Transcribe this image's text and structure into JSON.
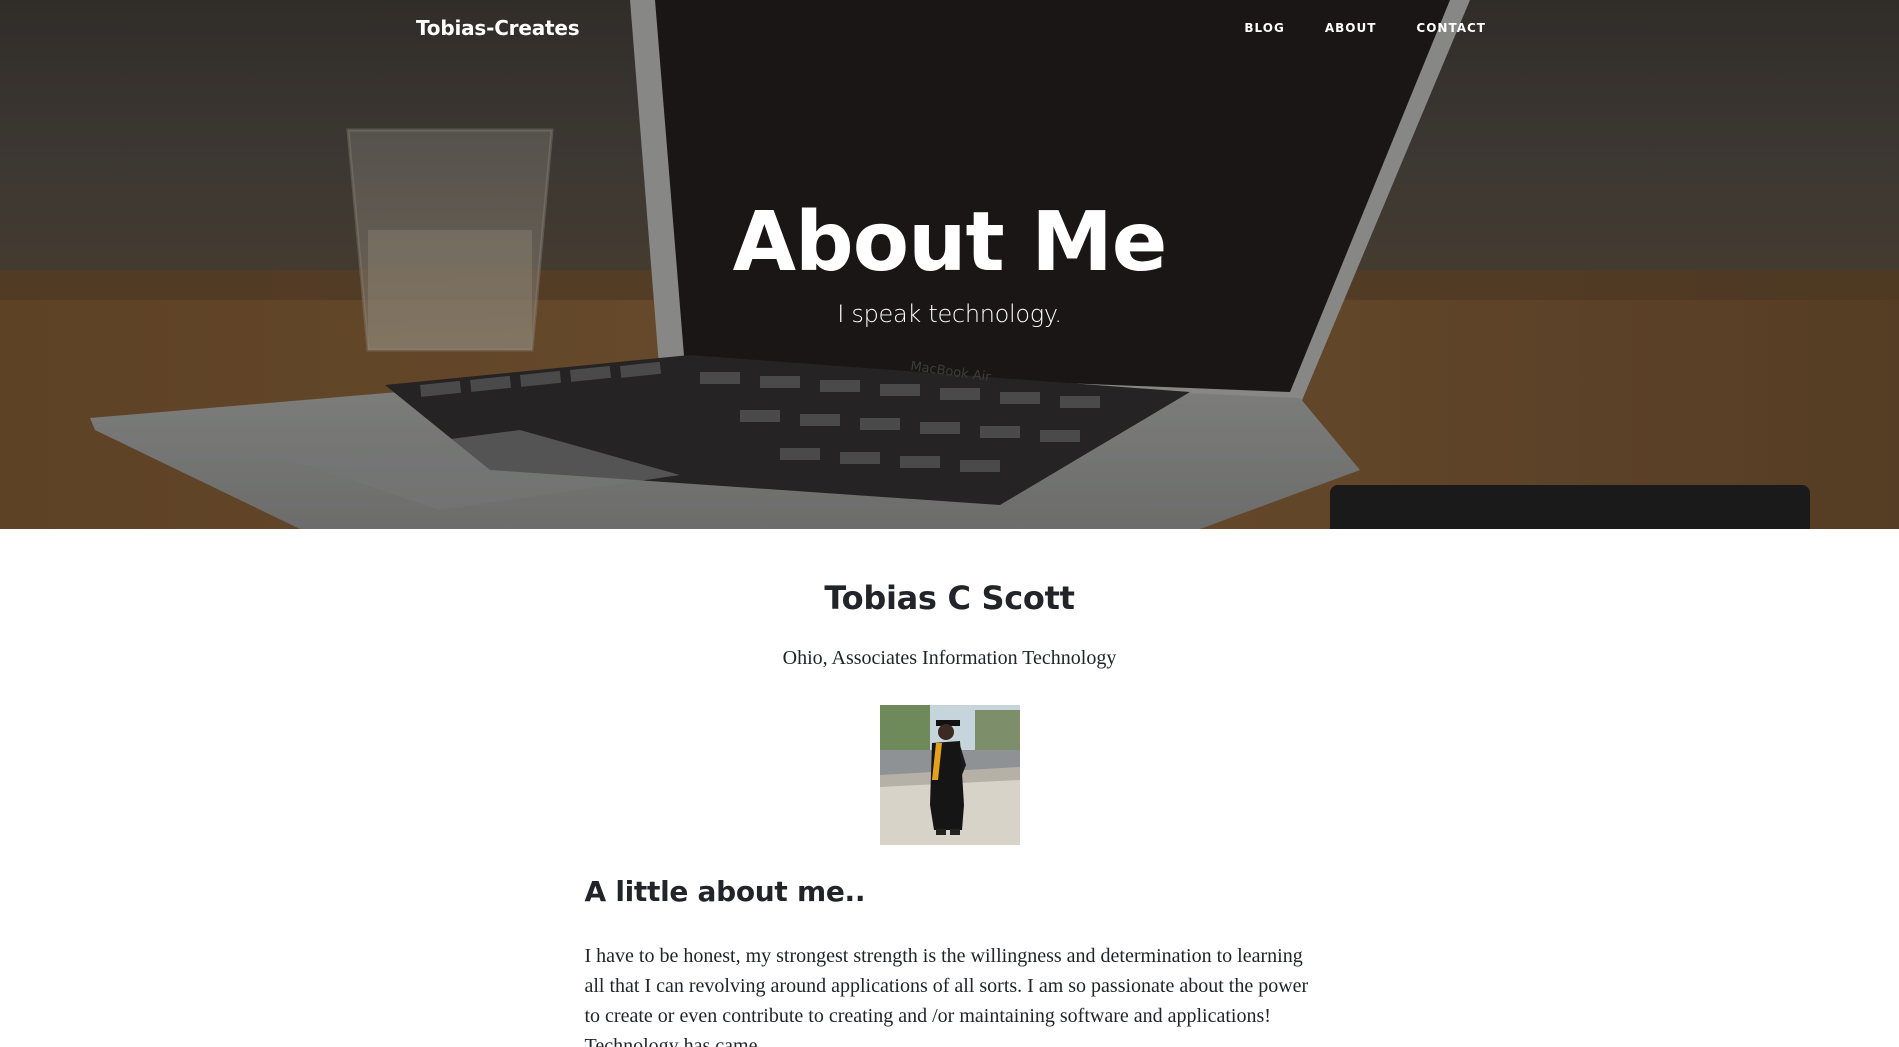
{
  "nav": {
    "brand": "Tobias-Creates",
    "links": [
      {
        "label": "Blog"
      },
      {
        "label": "About"
      },
      {
        "label": "Contact"
      }
    ]
  },
  "header": {
    "title": "About Me",
    "subtitle": "I speak technology.",
    "laptop_label": "MacBook Air"
  },
  "profile": {
    "name": "Tobias C Scott",
    "details": "Ohio, Associates Information Technology"
  },
  "about": {
    "heading": "A little about me..",
    "body": "I have to be honest, my strongest strength is the willingness and determination to learning all that I can revolving around applications of all sorts. I am so passionate about the power to create or even contribute to creating and /or maintaining software and applications! Technology has came"
  },
  "colors": {
    "text": "#212529",
    "hero_text": "#ffffff"
  }
}
